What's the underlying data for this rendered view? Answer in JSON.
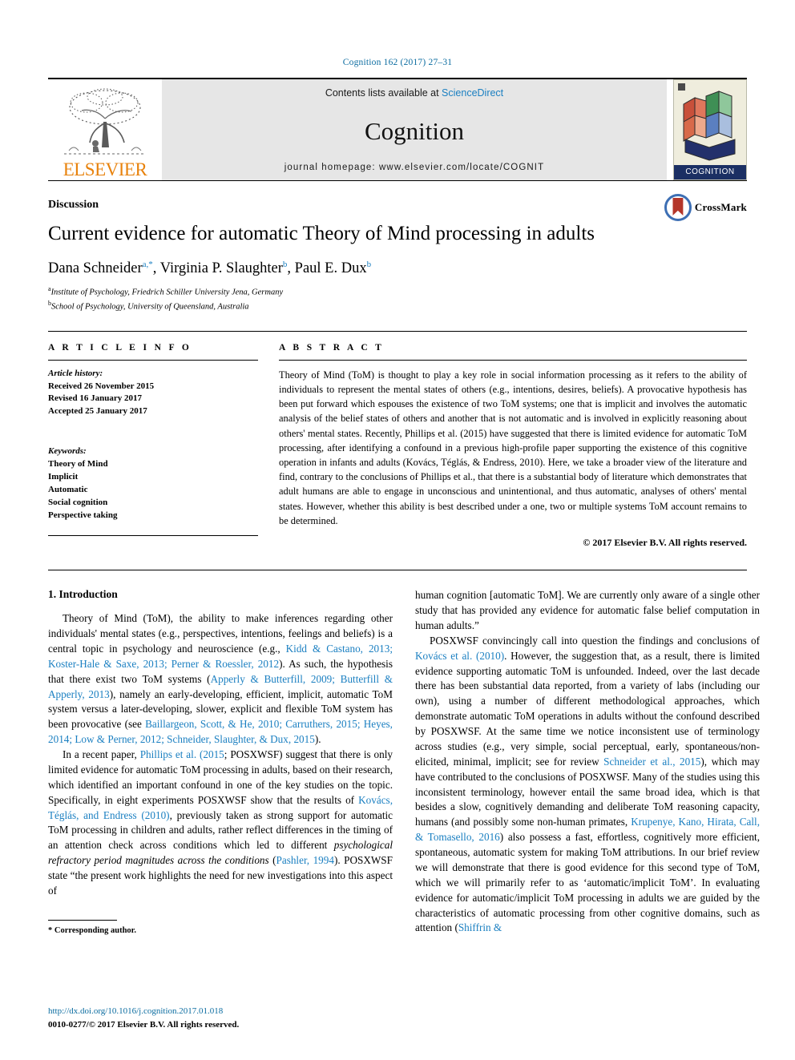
{
  "running_head": "Cognition 162 (2017) 27–31",
  "masthead": {
    "publisher": "ELSEVIER",
    "contents_prefix": "Contents lists available at ",
    "contents_link": "ScienceDirect",
    "journal_title": "Cognition",
    "homepage": "journal homepage: www.elsevier.com/locate/COGNIT",
    "cover_label": "COGNITION"
  },
  "article": {
    "section_label": "Discussion",
    "title": "Current evidence for automatic Theory of Mind processing in adults",
    "authors": "Dana Schneider",
    "author_1_sup": "a,*",
    "author_2": ", Virginia P. Slaughter",
    "author_2_sup": "b",
    "author_3": ", Paul E. Dux",
    "author_3_sup": "b",
    "affiliation_a_sup": "a",
    "affiliation_a": "Institute of Psychology, Friedrich Schiller University Jena, Germany",
    "affiliation_b_sup": "b",
    "affiliation_b": "School of Psychology, University of Queensland, Australia",
    "crossmark_label": "CrossMark"
  },
  "info": {
    "heading": "A R T I C L E    I N F O",
    "history_label": "Article history:",
    "received": "Received 26 November 2015",
    "revised": "Revised 16 January 2017",
    "accepted": "Accepted 25 January 2017",
    "keywords_label": "Keywords:",
    "keywords": [
      "Theory of Mind",
      "Implicit",
      "Automatic",
      "Social cognition",
      "Perspective taking"
    ]
  },
  "abstract": {
    "heading": "A B S T R A C T",
    "text": "Theory of Mind (ToM) is thought to play a key role in social information processing as it refers to the ability of individuals to represent the mental states of others (e.g., intentions, desires, beliefs). A provocative hypothesis has been put forward which espouses the existence of two ToM systems; one that is implicit and involves the automatic analysis of the belief states of others and another that is not automatic and is involved in explicitly reasoning about others' mental states. Recently, Phillips et al. (2015) have suggested that there is limited evidence for automatic ToM processing, after identifying a confound in a previous high-profile paper supporting the existence of this cognitive operation in infants and adults (Kovács, Téglás, & Endress, 2010). Here, we take a broader view of the literature and find, contrary to the conclusions of Phillips et al., that there is a substantial body of literature which demonstrates that adult humans are able to engage in unconscious and unintentional, and thus automatic, analyses of others' mental states. However, whether this ability is best described under a one, two or multiple systems ToM account remains to be determined.",
    "rights": "© 2017 Elsevier B.V. All rights reserved."
  },
  "body": {
    "section_number_title": "1. Introduction",
    "left_paragraphs": [
      {
        "parts": [
          {
            "t": "Theory of Mind (ToM), the ability to make inferences regarding other individuals' mental states (e.g., perspectives, intentions, feelings and beliefs) is a central topic in psychology and neuroscience (e.g., ",
            "s": "plain"
          },
          {
            "t": "Kidd & Castano, 2013; Koster-Hale & Saxe, 2013; Perner & Roessler, 2012",
            "s": "cite"
          },
          {
            "t": "). As such, the hypothesis that there exist two ToM systems (",
            "s": "plain"
          },
          {
            "t": "Apperly & Butterfill, 2009; Butterfill & Apperly, 2013",
            "s": "cite"
          },
          {
            "t": "), namely an early-developing, efficient, implicit, automatic ToM system versus a later-developing, slower, explicit and flexible ToM system has been provocative (see ",
            "s": "plain"
          },
          {
            "t": "Baillargeon, Scott, & He, 2010; Carruthers, 2015; Heyes, 2014; Low & Perner, 2012; Schneider, Slaughter, & Dux, 2015",
            "s": "cite"
          },
          {
            "t": ").",
            "s": "plain"
          }
        ]
      },
      {
        "parts": [
          {
            "t": "In a recent paper, ",
            "s": "plain"
          },
          {
            "t": "Phillips et al. (2015",
            "s": "cite"
          },
          {
            "t": "; POSXWSF) suggest that there is only limited evidence for automatic ToM processing in adults, based on their research, which identified an important confound in one of the key studies on the topic. Specifically, in eight experiments POSXWSF show that the results of ",
            "s": "plain"
          },
          {
            "t": "Kovács, Téglás, and Endress (2010)",
            "s": "cite"
          },
          {
            "t": ", previously taken as strong support for automatic ToM processing in children and adults, rather reflect differences in the timing of an attention check across conditions which led to different ",
            "s": "plain"
          },
          {
            "t": "psychological refractory period magnitudes across the conditions",
            "s": "italic"
          },
          {
            "t": " (",
            "s": "plain"
          },
          {
            "t": "Pashler, 1994",
            "s": "cite"
          },
          {
            "t": "). POSXWSF state “the present work highlights the need for new investigations into this aspect of",
            "s": "plain"
          }
        ]
      }
    ],
    "right_paragraphs": [
      {
        "parts": [
          {
            "t": "human cognition [automatic ToM]. We are currently only aware of a single other study that has provided any evidence for automatic false belief computation in human adults.”",
            "s": "plain"
          }
        ],
        "no_indent": true
      },
      {
        "parts": [
          {
            "t": "POSXWSF convincingly call into question the findings and conclusions of ",
            "s": "plain"
          },
          {
            "t": "Kovács et al. (2010)",
            "s": "cite"
          },
          {
            "t": ". However, the suggestion that, as a result, there is limited evidence supporting automatic ToM is unfounded. Indeed, over the last decade there has been substantial data reported, from a variety of labs (including our own), using a number of different methodological approaches, which demonstrate automatic ToM operations in adults without the confound described by POSXWSF. At the same time we notice inconsistent use of terminology across studies (e.g., very simple, social perceptual, early, spontaneous/non-elicited, minimal, implicit; see for review ",
            "s": "plain"
          },
          {
            "t": "Schneider et al., 2015",
            "s": "cite"
          },
          {
            "t": "), which may have contributed to the conclusions of POSXWSF. Many of the studies using this inconsistent terminology, however entail the same broad idea, which is that besides a slow, cognitively demanding and deliberate ToM reasoning capacity, humans (and possibly some non-human primates, ",
            "s": "plain"
          },
          {
            "t": "Krupenye, Kano, Hirata, Call, & Tomasello, 2016",
            "s": "cite"
          },
          {
            "t": ") also possess a fast, effortless, cognitively more efficient, spontaneous, automatic system for making ToM attributions. In our brief review we will demonstrate that there is good evidence for this second type of ToM, which we will primarily refer to as ‘automatic/implicit ToM’. In evaluating evidence for automatic/implicit ToM processing in adults we are guided by the characteristics of automatic processing from other cognitive domains, such as attention (",
            "s": "plain"
          },
          {
            "t": "Shiffrin &",
            "s": "cite"
          }
        ]
      }
    ],
    "footnote": "* Corresponding author."
  },
  "footer": {
    "doi": "http://dx.doi.org/10.1016/j.cognition.2017.01.018",
    "issn": "0010-0277/© 2017 Elsevier B.V. All rights reserved."
  },
  "colors": {
    "link_blue": "#1a7fc1",
    "header_blue": "#0b6ca0",
    "elsevier_orange": "#e8820c",
    "banner_gray": "#e6e6e6"
  }
}
